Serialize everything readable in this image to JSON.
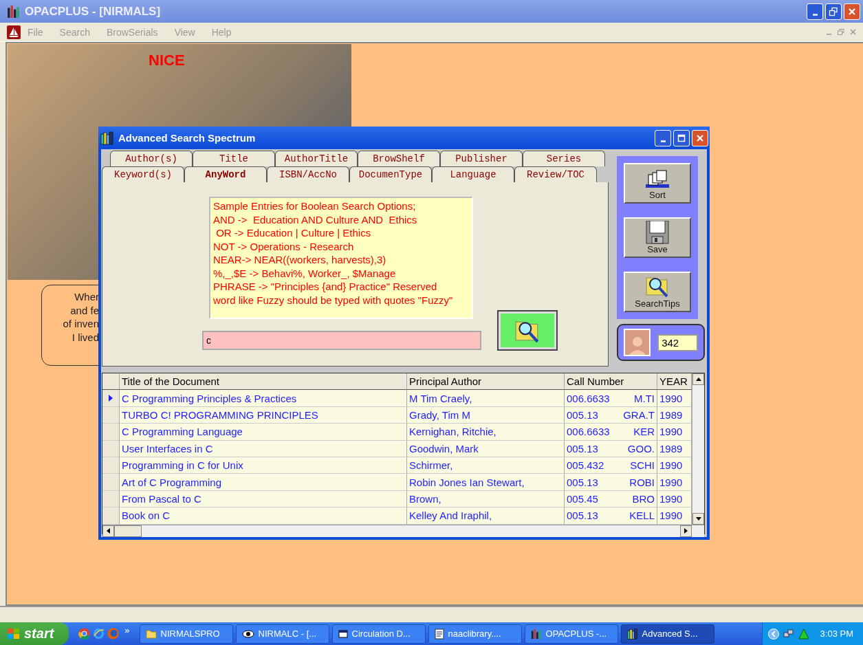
{
  "window": {
    "title": "OPACPLUS - [NIRMALS]"
  },
  "menu": [
    {
      "label": "File",
      "disabled": true
    },
    {
      "label": "Search",
      "disabled": true
    },
    {
      "label": "BrowSerials",
      "disabled": true
    },
    {
      "label": "View",
      "disabled": true
    },
    {
      "label": "Help",
      "disabled": true
    }
  ],
  "banner": {
    "caption": "NICE"
  },
  "note": {
    "lines": [
      "Wher",
      "and fe",
      "of inven",
      "I lived"
    ]
  },
  "dialog": {
    "title": "Advanced Search Spectrum",
    "tab_rows": [
      [
        {
          "label": "Author(s)",
          "selected": false
        },
        {
          "label": "Title",
          "selected": false
        },
        {
          "label": "AuthorTitle",
          "selected": false
        },
        {
          "label": "BrowShelf",
          "selected": false
        },
        {
          "label": "Publisher",
          "selected": false
        },
        {
          "label": "Series",
          "selected": false
        }
      ],
      [
        {
          "label": "Keyword(s)",
          "selected": false
        },
        {
          "label": "AnyWord",
          "selected": true
        },
        {
          "label": "ISBN/AccNo",
          "selected": false
        },
        {
          "label": "DocumenType",
          "selected": false
        },
        {
          "label": "Language",
          "selected": false
        },
        {
          "label": "Review/TOC",
          "selected": false
        }
      ]
    ],
    "hint_lines": [
      "Sample Entries for Boolean Search Options;",
      "AND ->  Education AND Culture AND  Ethics",
      " OR -> Education | Culture | Ethics",
      "NOT -> Operations - Research",
      "NEAR-> NEAR((workers, harvests),3)",
      "%,_,$E -> Behavi%, Worker_, $Manage",
      "PHRASE -> \"Principles {and} Practice\" Reserved",
      "word like Fuzzy should be typed with quotes \"Fuzzy\""
    ],
    "query": {
      "value": "c"
    },
    "side_buttons": [
      {
        "label": "Sort",
        "kind": "sort"
      },
      {
        "label": "Save",
        "kind": "save"
      },
      {
        "label": "SearchTips",
        "kind": "tips"
      }
    ],
    "count": "342",
    "table": {
      "columns": [
        "Title of the Document",
        "Principal Author",
        "Call Number",
        "YEAR"
      ],
      "rows": [
        {
          "title": "C Programming Principles & Practices",
          "author": "M Tim Craely,",
          "call_number": "006.6633",
          "call_mark": "M.TI",
          "year": "1990",
          "selected": true
        },
        {
          "title": "TURBO C! PROGRAMMING PRINCIPLES",
          "author": "Grady, Tim M",
          "call_number": "005.13",
          "call_mark": "GRA.T",
          "year": "1989",
          "selected": false
        },
        {
          "title": "C Programming Language",
          "author": "Kernighan, Ritchie,",
          "call_number": "006.6633",
          "call_mark": "KER",
          "year": "1990",
          "selected": false
        },
        {
          "title": "User Interfaces in C",
          "author": "Goodwin, Mark",
          "call_number": "005.13",
          "call_mark": "GOO.",
          "year": "1989",
          "selected": false
        },
        {
          "title": "Programming in C for Unix",
          "author": "Schirmer,",
          "call_number": "005.432",
          "call_mark": "SCHI",
          "year": "1990",
          "selected": false
        },
        {
          "title": "Art of C Programming",
          "author": "Robin Jones Ian Stewart,",
          "call_number": "005.13",
          "call_mark": "ROBI",
          "year": "1990",
          "selected": false
        },
        {
          "title": "From Pascal to C",
          "author": "Brown,",
          "call_number": "005.45",
          "call_mark": "BRO",
          "year": "1990",
          "selected": false
        },
        {
          "title": "Book on C",
          "author": "Kelley And Iraphil,",
          "call_number": "005.13",
          "call_mark": "KELL",
          "year": "1990",
          "selected": false
        }
      ]
    }
  },
  "taskbar": {
    "start": "start",
    "overflow": "»",
    "tasks": [
      {
        "label": "NIRMALSPRO",
        "kind": "folder",
        "selected": false
      },
      {
        "label": "NIRMALC - [...",
        "kind": "eye",
        "selected": false
      },
      {
        "label": "Circulation D...",
        "kind": "form",
        "selected": false
      },
      {
        "label": "naaclibrary....",
        "kind": "doc",
        "selected": false
      },
      {
        "label": "OPACPLUS -...",
        "kind": "bars",
        "selected": false
      },
      {
        "label": "Advanced S...",
        "kind": "books",
        "selected": true
      }
    ],
    "clock": "3:03 PM"
  }
}
